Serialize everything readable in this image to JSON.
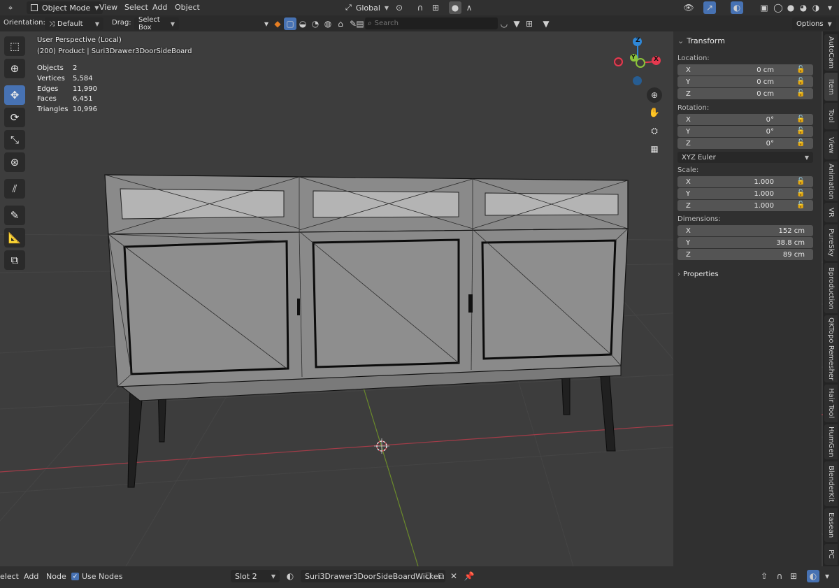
{
  "header": {
    "mode": "Object Mode",
    "menus": [
      "View",
      "Select",
      "Add",
      "Object"
    ],
    "transform_space": "Global"
  },
  "subheader": {
    "orientation_label": "Orientation:",
    "orientation_value": "Default",
    "drag_label": "Drag:",
    "drag_value": "Select Box",
    "search_placeholder": "Search",
    "options_label": "Options"
  },
  "viewport": {
    "perspective": "User Perspective (Local)",
    "object_info": "(200) Product | Suri3Drawer3DoorSideBoard",
    "stats": [
      {
        "label": "Objects",
        "value": "2"
      },
      {
        "label": "Vertices",
        "value": "5,584"
      },
      {
        "label": "Edges",
        "value": "11,990"
      },
      {
        "label": "Faces",
        "value": "6,451"
      },
      {
        "label": "Triangles",
        "value": "10,996"
      }
    ],
    "gizmo": {
      "x": "X",
      "y": "Y",
      "z": "Z"
    }
  },
  "npanel": {
    "title": "Transform",
    "location_label": "Location:",
    "location": [
      {
        "axis": "X",
        "value": "0 cm"
      },
      {
        "axis": "Y",
        "value": "0 cm"
      },
      {
        "axis": "Z",
        "value": "0 cm"
      }
    ],
    "rotation_label": "Rotation:",
    "rotation": [
      {
        "axis": "X",
        "value": "0°"
      },
      {
        "axis": "Y",
        "value": "0°"
      },
      {
        "axis": "Z",
        "value": "0°"
      }
    ],
    "rotation_mode": "XYZ Euler",
    "scale_label": "Scale:",
    "scale": [
      {
        "axis": "X",
        "value": "1.000"
      },
      {
        "axis": "Y",
        "value": "1.000"
      },
      {
        "axis": "Z",
        "value": "1.000"
      }
    ],
    "dimensions_label": "Dimensions:",
    "dimensions": [
      {
        "axis": "X",
        "value": "152 cm"
      },
      {
        "axis": "Y",
        "value": "38.8 cm"
      },
      {
        "axis": "Z",
        "value": "89 cm"
      }
    ],
    "properties_label": "Properties"
  },
  "tabs": [
    "AutoCam",
    "Item",
    "Tool",
    "View",
    "Animation",
    "VR",
    "PureSky",
    "Bproduction",
    "QKTopo Remesher",
    "Hair Tool",
    "HumGen",
    "BlenderKit",
    "Easean",
    "PC"
  ],
  "bottombar": {
    "menus": [
      "elect",
      "Add",
      "Node"
    ],
    "use_nodes_label": "Use Nodes",
    "use_nodes_checked": true,
    "slot": "Slot 2",
    "material": "Suri3Drawer3DoorSideBoardWicker"
  },
  "colors": {
    "accent": "#4772b3",
    "axis_x": "#e6394f",
    "axis_y": "#8cc43a",
    "axis_z": "#2f88d8"
  }
}
